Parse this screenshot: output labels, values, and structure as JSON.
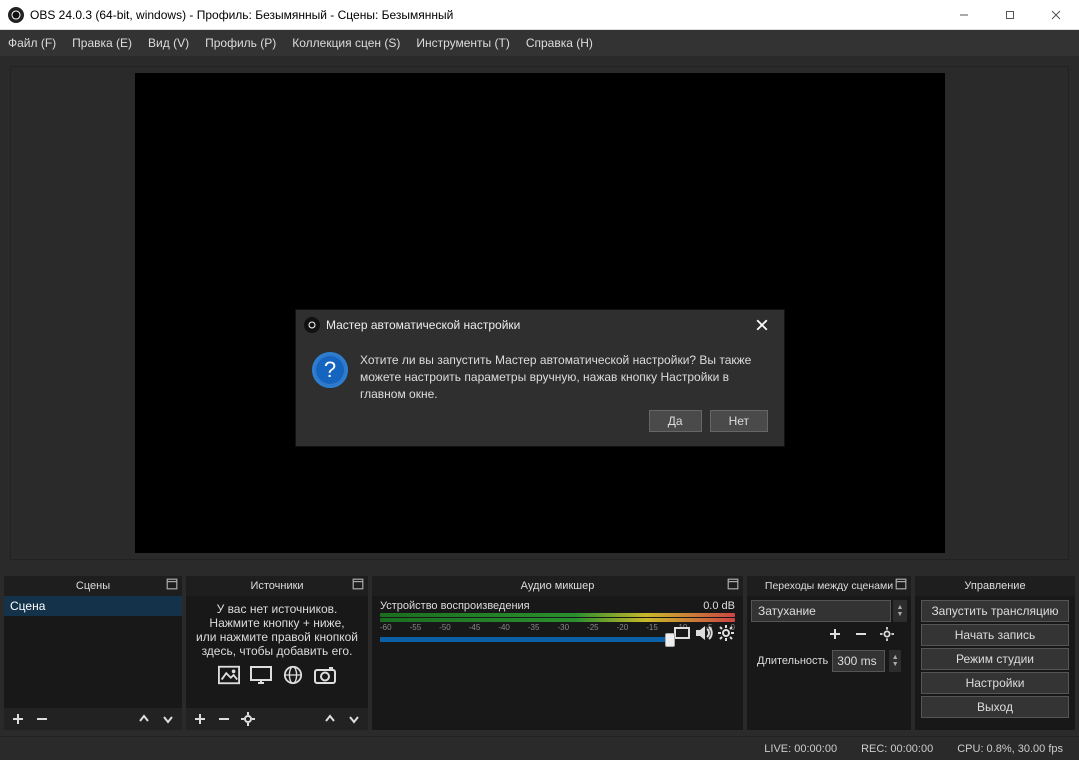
{
  "window": {
    "title": "OBS 24.0.3 (64-bit, windows) - Профиль: Безымянный - Сцены: Безымянный"
  },
  "menubar": {
    "items": [
      "Файл (F)",
      "Правка (E)",
      "Вид (V)",
      "Профиль (P)",
      "Коллекция сцен (S)",
      "Инструменты (T)",
      "Справка (H)"
    ]
  },
  "scenes": {
    "title": "Сцены",
    "items": [
      "Сцена"
    ]
  },
  "sources": {
    "title": "Источники",
    "empty_text": "У вас нет источников.\nНажмите кнопку + ниже,\nили нажмите правой кнопкой здесь, чтобы добавить его."
  },
  "mixer": {
    "title": "Аудио микшер",
    "device_label": "Устройство воспроизведения",
    "db_value": "0.0 dB",
    "ticks": [
      "-60",
      "-55",
      "-50",
      "-45",
      "-40",
      "-35",
      "-30",
      "-25",
      "-20",
      "-15",
      "-10",
      "-5",
      "0"
    ]
  },
  "transitions": {
    "title": "Переходы между сценами",
    "selected": "Затухание",
    "duration_label": "Длительность",
    "duration_value": "300 ms"
  },
  "controls": {
    "title": "Управление",
    "buttons": {
      "start_stream": "Запустить трансляцию",
      "start_record": "Начать запись",
      "studio_mode": "Режим студии",
      "settings": "Настройки",
      "exit": "Выход"
    }
  },
  "statusbar": {
    "live": "LIVE: 00:00:00",
    "rec": "REC: 00:00:00",
    "cpu": "CPU: 0.8%, 30.00 fps"
  },
  "modal": {
    "title": "Мастер автоматической настройки",
    "body": "Хотите ли вы запустить Мастер автоматической настройки? Вы также можете настроить параметры вручную, нажав кнопку Настройки в главном окне.",
    "yes": "Да",
    "no": "Нет",
    "icon_glyph": "?"
  }
}
